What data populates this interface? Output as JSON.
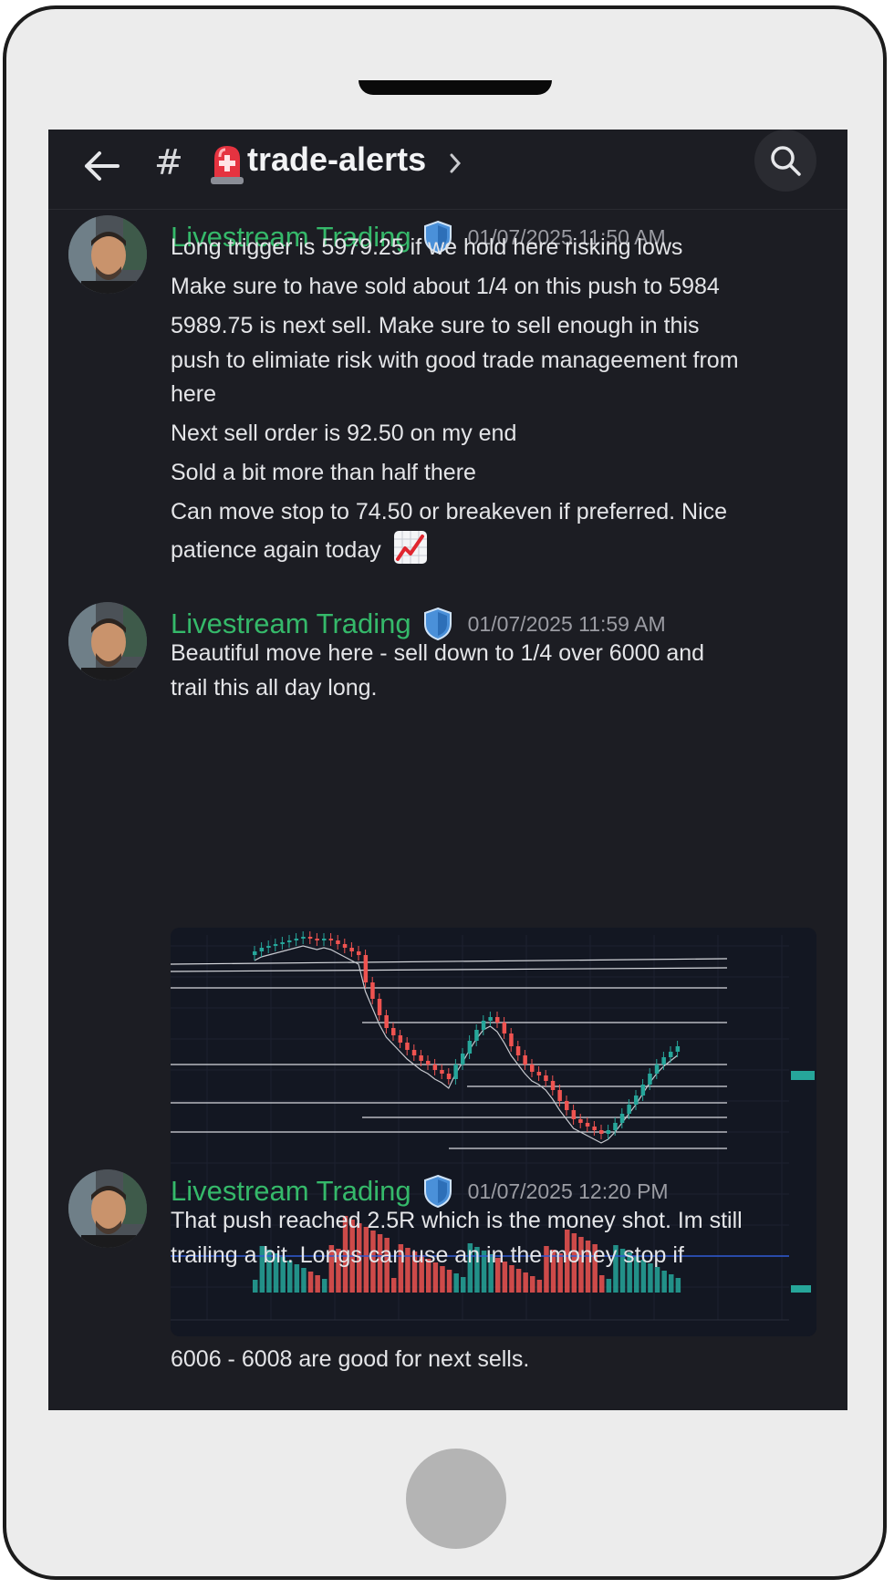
{
  "channel": {
    "name": "trade-alerts",
    "hash_icon": "#"
  },
  "icons": {
    "back": "back-arrow-icon",
    "channel_type": "hash-icon",
    "alarm": "rotating-light-emoji",
    "chevron": "chevron-right-icon",
    "search": "search-icon",
    "badge": "shield-icon",
    "chart_emoji": "chart-increasing-emoji"
  },
  "colors": {
    "author": "#35b96a",
    "background": "#1c1d23",
    "badge": "#4a90d9",
    "candle_up": "#26a69a",
    "candle_down": "#ef5350"
  },
  "messages": [
    {
      "author": "Livestream Trading",
      "timestamp": "01/07/2025 11:50 AM",
      "lines": [
        "Long trigger is 5979.25 if we hold here risking lows",
        "Make sure to have sold about 1/4 on this push to 5984",
        "5989.75 is next sell. Make sure to sell enough in this",
        "push to elimiate risk with good trade manageement from",
        "here",
        "Next sell order is 92.50  on my end",
        "Sold a bit more than half there",
        "Can move stop to 74.50 or breakeven if preferred. Nice",
        "patience again today"
      ]
    },
    {
      "author": "Livestream Trading",
      "timestamp": "01/07/2025 11:59 AM",
      "lines": [
        "Beautiful move here - sell down to 1/4 over 6000 and",
        "trail this all day long."
      ],
      "after_image": "6006 - 6008 are good for next sells."
    },
    {
      "author": "Livestream Trading",
      "timestamp": "01/07/2025 12:20 PM",
      "lines": [
        "That push reached 2.5R which is the money shot. Im still",
        "trailing a bit. Longs can use an in the money stop if"
      ]
    }
  ]
}
